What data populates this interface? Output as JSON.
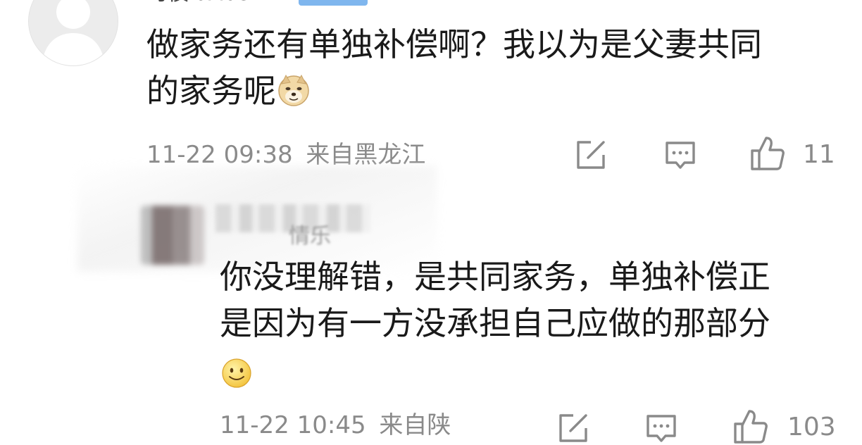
{
  "comments": [
    {
      "username": "习惯IdAbe",
      "badge": "",
      "text_line1": "做家务还有单独补偿啊？我以为是父妻共同",
      "text_line2": "的家务呢",
      "emoji": "doge-emoji",
      "timestamp": "11-22 09:38",
      "location": "来自黑龙江",
      "like_count": "11"
    },
    {
      "username": "",
      "username_partial": "情乐",
      "text_line1": "你没理解错，是共同家务，单独补偿正",
      "text_line2": "是因为有一方没承担自己应做的那部分",
      "emoji": "smile-emoji",
      "timestamp": "11-22 10:45",
      "location": "来自陕",
      "like_count": "103"
    }
  ],
  "icons": {
    "edit": "edit-icon",
    "reply": "comment-icon",
    "like": "thumbs-up-icon"
  },
  "colors": {
    "text": "#1a1a1a",
    "meta": "#8a8a8a",
    "badge": "#7fb6ee"
  }
}
